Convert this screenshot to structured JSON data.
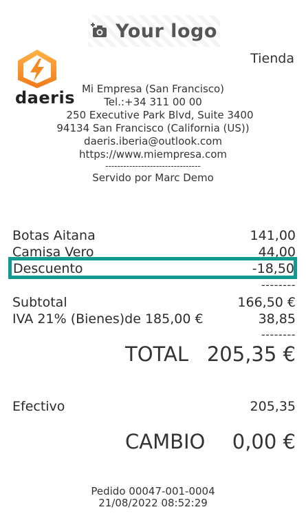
{
  "header": {
    "logo_placeholder_text": "Your logo",
    "brand_name": "daeris",
    "shop_label": "Tienda",
    "accent_color": "#109a92"
  },
  "company": {
    "name": "Mi Empresa (San Francisco)",
    "phone": "Tel.:+34 311 00 00",
    "address_line": "250 Executive Park Blvd, Suite 3400",
    "city_line": "94134 San Francisco (California (US))",
    "email": "daeris.iberia@outlook.com",
    "website": "https://www.miempresa.com",
    "separator": "--------------------------------",
    "served_by": "Servido por Marc Demo"
  },
  "lines": [
    {
      "label": "Botas Aitana",
      "value": "141,00"
    },
    {
      "label": "Camisa Vero",
      "value": "44,00"
    },
    {
      "label": "Descuento",
      "value": "-18,50"
    }
  ],
  "dash_short": "--------",
  "subtotal": {
    "label": "Subtotal",
    "value": "166,50 €"
  },
  "tax": {
    "label": "IVA 21% (Bienes)de 185,00 €",
    "value": "38,85"
  },
  "total": {
    "label": "TOTAL",
    "value": "205,35 €"
  },
  "payment": {
    "label": "Efectivo",
    "value": "205,35"
  },
  "change": {
    "label": "CAMBIO",
    "value": "0,00 €"
  },
  "footer": {
    "order": "Pedido 00047-001-0004",
    "datetime": "21/08/2022 08:52:29"
  }
}
